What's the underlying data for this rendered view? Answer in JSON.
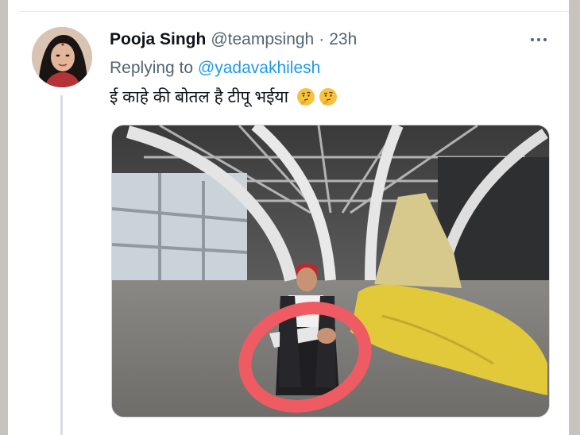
{
  "tweet": {
    "author_name": "Pooja Singh",
    "author_handle": "@teampsingh",
    "separator": "·",
    "time": "23h",
    "replying_prefix": "Replying to",
    "replying_to": "@yadavakhilesh",
    "text": "ई काहे की बोतल है टीपू भईया",
    "emojis": [
      "thinking-face-emoji",
      "thinking-face-emoji"
    ]
  },
  "colors": {
    "name": "#0f1419",
    "secondary": "#536471",
    "link": "#1d9bf0",
    "annotation_circle": "#ef5b63",
    "cloth": "#e1c93a"
  }
}
